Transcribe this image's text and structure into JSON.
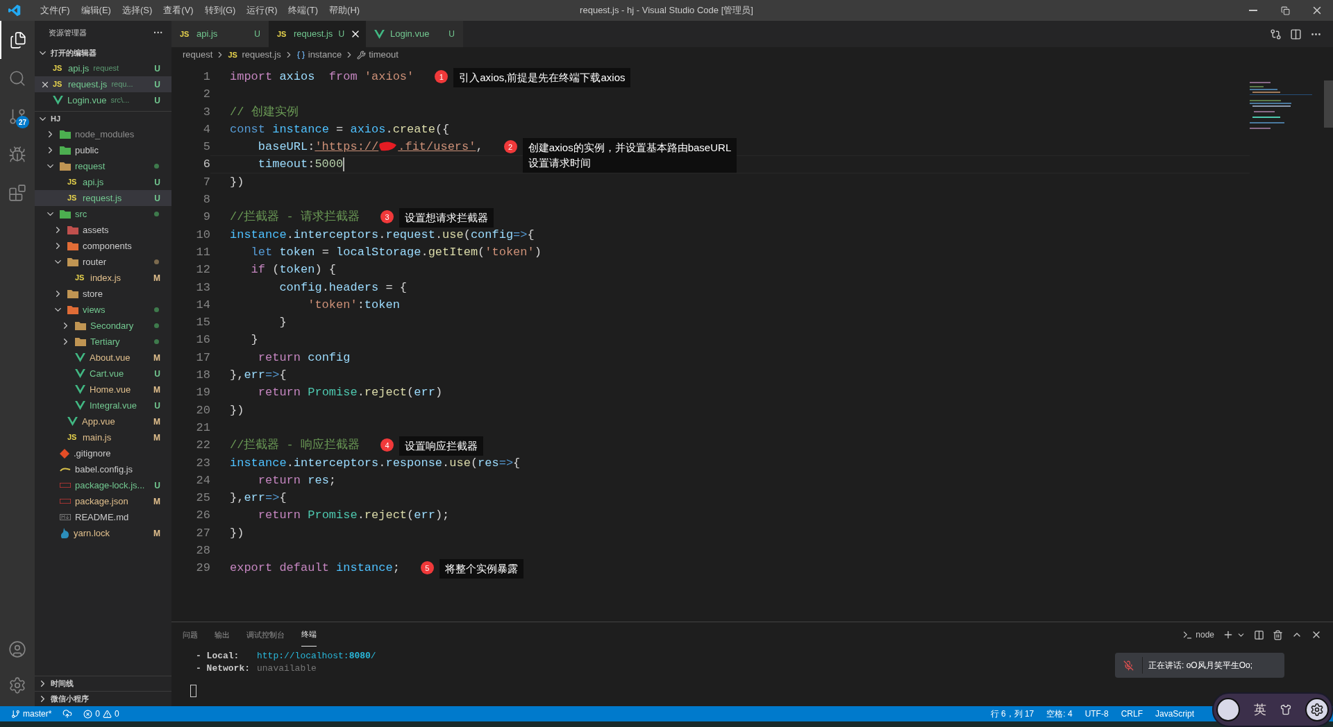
{
  "window": {
    "title": "request.js - hj - Visual Studio Code [管理员]"
  },
  "menu": [
    "文件(F)",
    "编辑(E)",
    "选择(S)",
    "查看(V)",
    "转到(G)",
    "运行(R)",
    "终端(T)",
    "帮助(H)"
  ],
  "activity_bar": [
    {
      "kind": "files",
      "selected": true
    },
    {
      "kind": "search",
      "selected": false
    },
    {
      "kind": "branch",
      "selected": false,
      "badge": "27"
    },
    {
      "kind": "debug",
      "selected": false
    },
    {
      "kind": "extensions",
      "selected": false
    }
  ],
  "activity_bottom": [
    {
      "kind": "account"
    },
    {
      "kind": "settings"
    }
  ],
  "sidebar": {
    "title": "资源管理器",
    "more": "···",
    "open_editors": {
      "title": "打开的编辑器",
      "expanded": true,
      "items": [
        {
          "name": "api.js",
          "kind": "js",
          "icon_label": "JS",
          "path": "request",
          "badge": "U",
          "color": "#73c991",
          "selected": false
        },
        {
          "name": "request.js",
          "kind": "js",
          "icon_label": "JS",
          "path": "requ...",
          "badge": "U",
          "color": "#73c991",
          "selected": true
        },
        {
          "name": "Login.vue",
          "kind": "vue",
          "path": "src\\...",
          "badge": "U",
          "color": "#73c991",
          "selected": false
        }
      ]
    },
    "project": {
      "title": "HJ",
      "expanded": true,
      "items": [
        {
          "name": "node_modules",
          "kind": "folder-green",
          "expanded": false,
          "color": "#8c8c8c",
          "selected": false
        },
        {
          "name": "public",
          "kind": "folder-green",
          "expanded": false,
          "color": "#cccccc",
          "selected": false
        },
        {
          "name": "request",
          "kind": "folder",
          "expanded": true,
          "color": "#73c991",
          "dot": {
            "color": "#3e7a4c"
          },
          "selected": false,
          "children": [
            {
              "name": "api.js",
              "kind": "js",
              "icon_label": "JS",
              "badge": "U",
              "color": "#73c991",
              "selected": false
            },
            {
              "name": "request.js",
              "kind": "js",
              "icon_label": "JS",
              "badge": "U",
              "color": "#73c991",
              "selected": true
            }
          ]
        },
        {
          "name": "src",
          "kind": "folder-green",
          "expanded": true,
          "color": "#73c991",
          "dot": {
            "color": "#3e7a4c"
          },
          "selected": false,
          "children": [
            {
              "name": "assets",
              "kind": "folder-red",
              "expanded": false,
              "color": "#cccccc",
              "selected": false
            },
            {
              "name": "components",
              "kind": "folder-orange",
              "expanded": false,
              "color": "#cccccc",
              "selected": false
            },
            {
              "name": "router",
              "kind": "folder",
              "expanded": true,
              "color": "#cccccc",
              "dot": {
                "color": "#7c6a4e"
              },
              "selected": false,
              "children": [
                {
                  "name": "index.js",
                  "kind": "js",
                  "icon_label": "JS",
                  "badge": "M",
                  "color": "#e2c08d",
                  "selected": false
                }
              ]
            },
            {
              "name": "store",
              "kind": "folder",
              "expanded": false,
              "color": "#cccccc",
              "selected": false
            },
            {
              "name": "views",
              "kind": "folder-orange",
              "expanded": true,
              "color": "#73c991",
              "dot": {
                "color": "#3e7a4c"
              },
              "selected": false,
              "children": [
                {
                  "name": "Secondary",
                  "kind": "folder",
                  "expanded": false,
                  "color": "#73c991",
                  "dot": {
                    "color": "#3e7a4c"
                  },
                  "selected": false
                },
                {
                  "name": "Tertiary",
                  "kind": "folder",
                  "expanded": false,
                  "color": "#73c991",
                  "dot": {
                    "color": "#3e7a4c"
                  },
                  "selected": false
                },
                {
                  "name": "About.vue",
                  "kind": "vue",
                  "badge": "M",
                  "color": "#e2c08d",
                  "selected": false
                },
                {
                  "name": "Cart.vue",
                  "kind": "vue",
                  "badge": "U",
                  "color": "#73c991",
                  "selected": false
                },
                {
                  "name": "Home.vue",
                  "kind": "vue",
                  "badge": "M",
                  "color": "#e2c08d",
                  "selected": false
                },
                {
                  "name": "Integral.vue",
                  "kind": "vue",
                  "badge": "U",
                  "color": "#73c991",
                  "selected": false
                }
              ]
            },
            {
              "name": "App.vue",
              "kind": "vue",
              "badge": "M",
              "color": "#e2c08d",
              "selected": false
            },
            {
              "name": "main.js",
              "kind": "js",
              "icon_label": "JS",
              "badge": "M",
              "color": "#e2c08d",
              "selected": false
            }
          ]
        },
        {
          "name": ".gitignore",
          "kind": "git",
          "color": "#cccccc",
          "selected": false
        },
        {
          "name": "babel.config.js",
          "kind": "babel",
          "color": "#cccccc",
          "selected": false
        },
        {
          "name": "package-lock.js...",
          "kind": "npm",
          "badge": "U",
          "color": "#73c991",
          "selected": false
        },
        {
          "name": "package.json",
          "kind": "npm",
          "badge": "M",
          "color": "#e2c08d",
          "selected": false
        },
        {
          "name": "README.md",
          "kind": "md",
          "color": "#cccccc",
          "selected": false
        },
        {
          "name": "yarn.lock",
          "kind": "yarn",
          "badge": "M",
          "color": "#e2c08d",
          "selected": false
        }
      ]
    },
    "sections": [
      {
        "title": "时间线",
        "expanded": false
      },
      {
        "title": "微信小程序",
        "expanded": false
      }
    ]
  },
  "tabs": [
    {
      "label": "api.js",
      "kind": "js",
      "icon_label": "JS",
      "badge": "U",
      "selected": false
    },
    {
      "label": "request.js",
      "kind": "js",
      "icon_label": "JS",
      "badge": "U",
      "selected": true
    },
    {
      "label": "Login.vue",
      "kind": "vue",
      "badge": "U",
      "selected": false
    }
  ],
  "breadcrumb": [
    {
      "label": "request",
      "kind": "folder"
    },
    {
      "label": "request.js",
      "kind": "js",
      "icon_label": "JS"
    },
    {
      "label": "instance",
      "kind": "variable"
    },
    {
      "label": "timeout",
      "kind": "property"
    }
  ],
  "code": [
    {
      "number": "1",
      "current": false,
      "tokens": [
        {
          "t": "import",
          "kind": "kw"
        },
        {
          "t": " axios  ",
          "kind": "var"
        },
        {
          "t": "from",
          "kind": "kw"
        },
        {
          "t": " 'axios'",
          "kind": "str"
        }
      ],
      "note": {
        "number": "1",
        "text": "引入axios,前提是先在终端下载axios"
      }
    },
    {
      "number": "2",
      "current": false
    },
    {
      "number": "3",
      "current": false,
      "tokens": [
        {
          "t": "// 创建实例",
          "kind": "cm"
        }
      ]
    },
    {
      "number": "4",
      "current": false,
      "tokens": [
        {
          "t": "const",
          "kind": "storage"
        },
        {
          "t": " instance",
          "kind": "const"
        },
        {
          "t": " = ",
          "kind": "plain"
        },
        {
          "t": "axios",
          "kind": "const"
        },
        {
          "t": ".",
          "kind": "plain"
        },
        {
          "t": "create",
          "kind": "fn"
        },
        {
          "t": "({",
          "kind": "plain"
        }
      ]
    },
    {
      "number": "5",
      "current": false,
      "tokens": [
        {
          "t": "    baseURL",
          "kind": "var"
        },
        {
          "t": ":",
          "kind": "plain"
        },
        {
          "t": "'https://",
          "kind": "url"
        },
        {
          "kind": "redacted"
        },
        {
          "t": ".fit/users'",
          "kind": "url"
        },
        {
          "t": ",",
          "kind": "plain"
        }
      ],
      "note": {
        "number": "2",
        "text": "创建axios的实例，并设置基本路由baseURL\n设置请求时间"
      }
    },
    {
      "number": "6",
      "current": true,
      "tokens": [
        {
          "t": "    timeout",
          "kind": "var"
        },
        {
          "t": ":",
          "kind": "plain"
        },
        {
          "t": "5000",
          "kind": "num"
        }
      ]
    },
    {
      "number": "7",
      "current": false,
      "tokens": [
        {
          "t": "})",
          "kind": "plain"
        }
      ]
    },
    {
      "number": "8",
      "current": false
    },
    {
      "number": "9",
      "current": false,
      "tokens": [
        {
          "t": "//拦截器 - 请求拦截器",
          "kind": "cm"
        }
      ],
      "note": {
        "number": "3",
        "text": "设置想请求拦截器"
      }
    },
    {
      "number": "10",
      "current": false,
      "tokens": [
        {
          "t": "instance",
          "kind": "const"
        },
        {
          "t": ".",
          "kind": "plain"
        },
        {
          "t": "interceptors",
          "kind": "var"
        },
        {
          "t": ".",
          "kind": "plain"
        },
        {
          "t": "request",
          "kind": "var"
        },
        {
          "t": ".",
          "kind": "plain"
        },
        {
          "t": "use",
          "kind": "fn"
        },
        {
          "t": "(",
          "kind": "plain"
        },
        {
          "t": "config",
          "kind": "var"
        },
        {
          "t": "=>",
          "kind": "storage"
        },
        {
          "t": "{",
          "kind": "plain"
        }
      ]
    },
    {
      "number": "11",
      "current": false,
      "tokens": [
        {
          "t": "   let",
          "kind": "storage"
        },
        {
          "t": " token",
          "kind": "var"
        },
        {
          "t": " = ",
          "kind": "plain"
        },
        {
          "t": "localStorage",
          "kind": "var"
        },
        {
          "t": ".",
          "kind": "plain"
        },
        {
          "t": "getItem",
          "kind": "fn"
        },
        {
          "t": "(",
          "kind": "plain"
        },
        {
          "t": "'token'",
          "kind": "str"
        },
        {
          "t": ")",
          "kind": "plain"
        }
      ]
    },
    {
      "number": "12",
      "current": false,
      "tokens": [
        {
          "t": "   if",
          "kind": "kw"
        },
        {
          "t": " (",
          "kind": "plain"
        },
        {
          "t": "token",
          "kind": "var"
        },
        {
          "t": ") {",
          "kind": "plain"
        }
      ]
    },
    {
      "number": "13",
      "current": false,
      "tokens": [
        {
          "t": "       config",
          "kind": "var"
        },
        {
          "t": ".",
          "kind": "plain"
        },
        {
          "t": "headers",
          "kind": "var"
        },
        {
          "t": " = {",
          "kind": "plain"
        }
      ]
    },
    {
      "number": "14",
      "current": false,
      "tokens": [
        {
          "t": "           'token'",
          "kind": "str"
        },
        {
          "t": ":",
          "kind": "plain"
        },
        {
          "t": "token",
          "kind": "var"
        }
      ]
    },
    {
      "number": "15",
      "current": false,
      "tokens": [
        {
          "t": "       }",
          "kind": "plain"
        }
      ]
    },
    {
      "number": "16",
      "current": false,
      "tokens": [
        {
          "t": "   }",
          "kind": "plain"
        }
      ]
    },
    {
      "number": "17",
      "current": false,
      "tokens": [
        {
          "t": "    return",
          "kind": "kw"
        },
        {
          "t": " config",
          "kind": "var"
        }
      ]
    },
    {
      "number": "18",
      "current": false,
      "tokens": [
        {
          "t": "},",
          "kind": "plain"
        },
        {
          "t": "err",
          "kind": "var"
        },
        {
          "t": "=>",
          "kind": "storage"
        },
        {
          "t": "{",
          "kind": "plain"
        }
      ]
    },
    {
      "number": "19",
      "current": false,
      "tokens": [
        {
          "t": "    return",
          "kind": "kw"
        },
        {
          "t": " Promise",
          "kind": "type"
        },
        {
          "t": ".",
          "kind": "plain"
        },
        {
          "t": "reject",
          "kind": "fn"
        },
        {
          "t": "(",
          "kind": "plain"
        },
        {
          "t": "err",
          "kind": "var"
        },
        {
          "t": ")",
          "kind": "plain"
        }
      ]
    },
    {
      "number": "20",
      "current": false,
      "tokens": [
        {
          "t": "})",
          "kind": "plain"
        }
      ]
    },
    {
      "number": "21",
      "current": false
    },
    {
      "number": "22",
      "current": false,
      "tokens": [
        {
          "t": "//拦截器 - 响应拦截器",
          "kind": "cm"
        }
      ],
      "note": {
        "number": "4",
        "text": "设置响应拦截器"
      }
    },
    {
      "number": "23",
      "current": false,
      "tokens": [
        {
          "t": "instance",
          "kind": "const"
        },
        {
          "t": ".",
          "kind": "plain"
        },
        {
          "t": "interceptors",
          "kind": "var"
        },
        {
          "t": ".",
          "kind": "plain"
        },
        {
          "t": "response",
          "kind": "var"
        },
        {
          "t": ".",
          "kind": "plain"
        },
        {
          "t": "use",
          "kind": "fn"
        },
        {
          "t": "(",
          "kind": "plain"
        },
        {
          "t": "res",
          "kind": "var"
        },
        {
          "t": "=>",
          "kind": "storage"
        },
        {
          "t": "{",
          "kind": "plain"
        }
      ]
    },
    {
      "number": "24",
      "current": false,
      "tokens": [
        {
          "t": "    return",
          "kind": "kw"
        },
        {
          "t": " res",
          "kind": "var"
        },
        {
          "t": ";",
          "kind": "plain"
        }
      ]
    },
    {
      "number": "25",
      "current": false,
      "tokens": [
        {
          "t": "},",
          "kind": "plain"
        },
        {
          "t": "err",
          "kind": "var"
        },
        {
          "t": "=>",
          "kind": "storage"
        },
        {
          "t": "{",
          "kind": "plain"
        }
      ]
    },
    {
      "number": "26",
      "current": false,
      "tokens": [
        {
          "t": "    return",
          "kind": "kw"
        },
        {
          "t": " Promise",
          "kind": "type"
        },
        {
          "t": ".",
          "kind": "plain"
        },
        {
          "t": "reject",
          "kind": "fn"
        },
        {
          "t": "(",
          "kind": "plain"
        },
        {
          "t": "err",
          "kind": "var"
        },
        {
          "t": ");",
          "kind": "plain"
        }
      ]
    },
    {
      "number": "27",
      "current": false,
      "tokens": [
        {
          "t": "})",
          "kind": "plain"
        }
      ]
    },
    {
      "number": "28",
      "current": false
    },
    {
      "number": "29",
      "current": false,
      "tokens": [
        {
          "t": "export",
          "kind": "kw"
        },
        {
          "t": " default",
          "kind": "kw"
        },
        {
          "t": " instance",
          "kind": "const"
        },
        {
          "t": ";",
          "kind": "plain"
        }
      ],
      "note": {
        "number": "5",
        "text": "将整个实例暴露"
      }
    }
  ],
  "panel": {
    "tabs": [
      {
        "label": "问题",
        "selected": false
      },
      {
        "label": "输出",
        "selected": false
      },
      {
        "label": "调试控制台",
        "selected": false
      },
      {
        "label": "终端",
        "selected": true
      }
    ],
    "terminal_name": "node",
    "terminal": [
      {
        "label": "- Local:",
        "value": "http://localhost:",
        "port": "8080",
        "tail": "/"
      },
      {
        "label": "- Network:",
        "note": "unavailable"
      }
    ]
  },
  "notification": {
    "text": "正在讲话: oO风月笑平生Oo;"
  },
  "status_bar": {
    "branch": "master*",
    "errors": "0",
    "warnings": "0",
    "right": [
      "行 6，列 17",
      "空格: 4",
      "UTF-8",
      "CRLF",
      "JavaScript"
    ]
  },
  "ime": {
    "mode": "英"
  }
}
